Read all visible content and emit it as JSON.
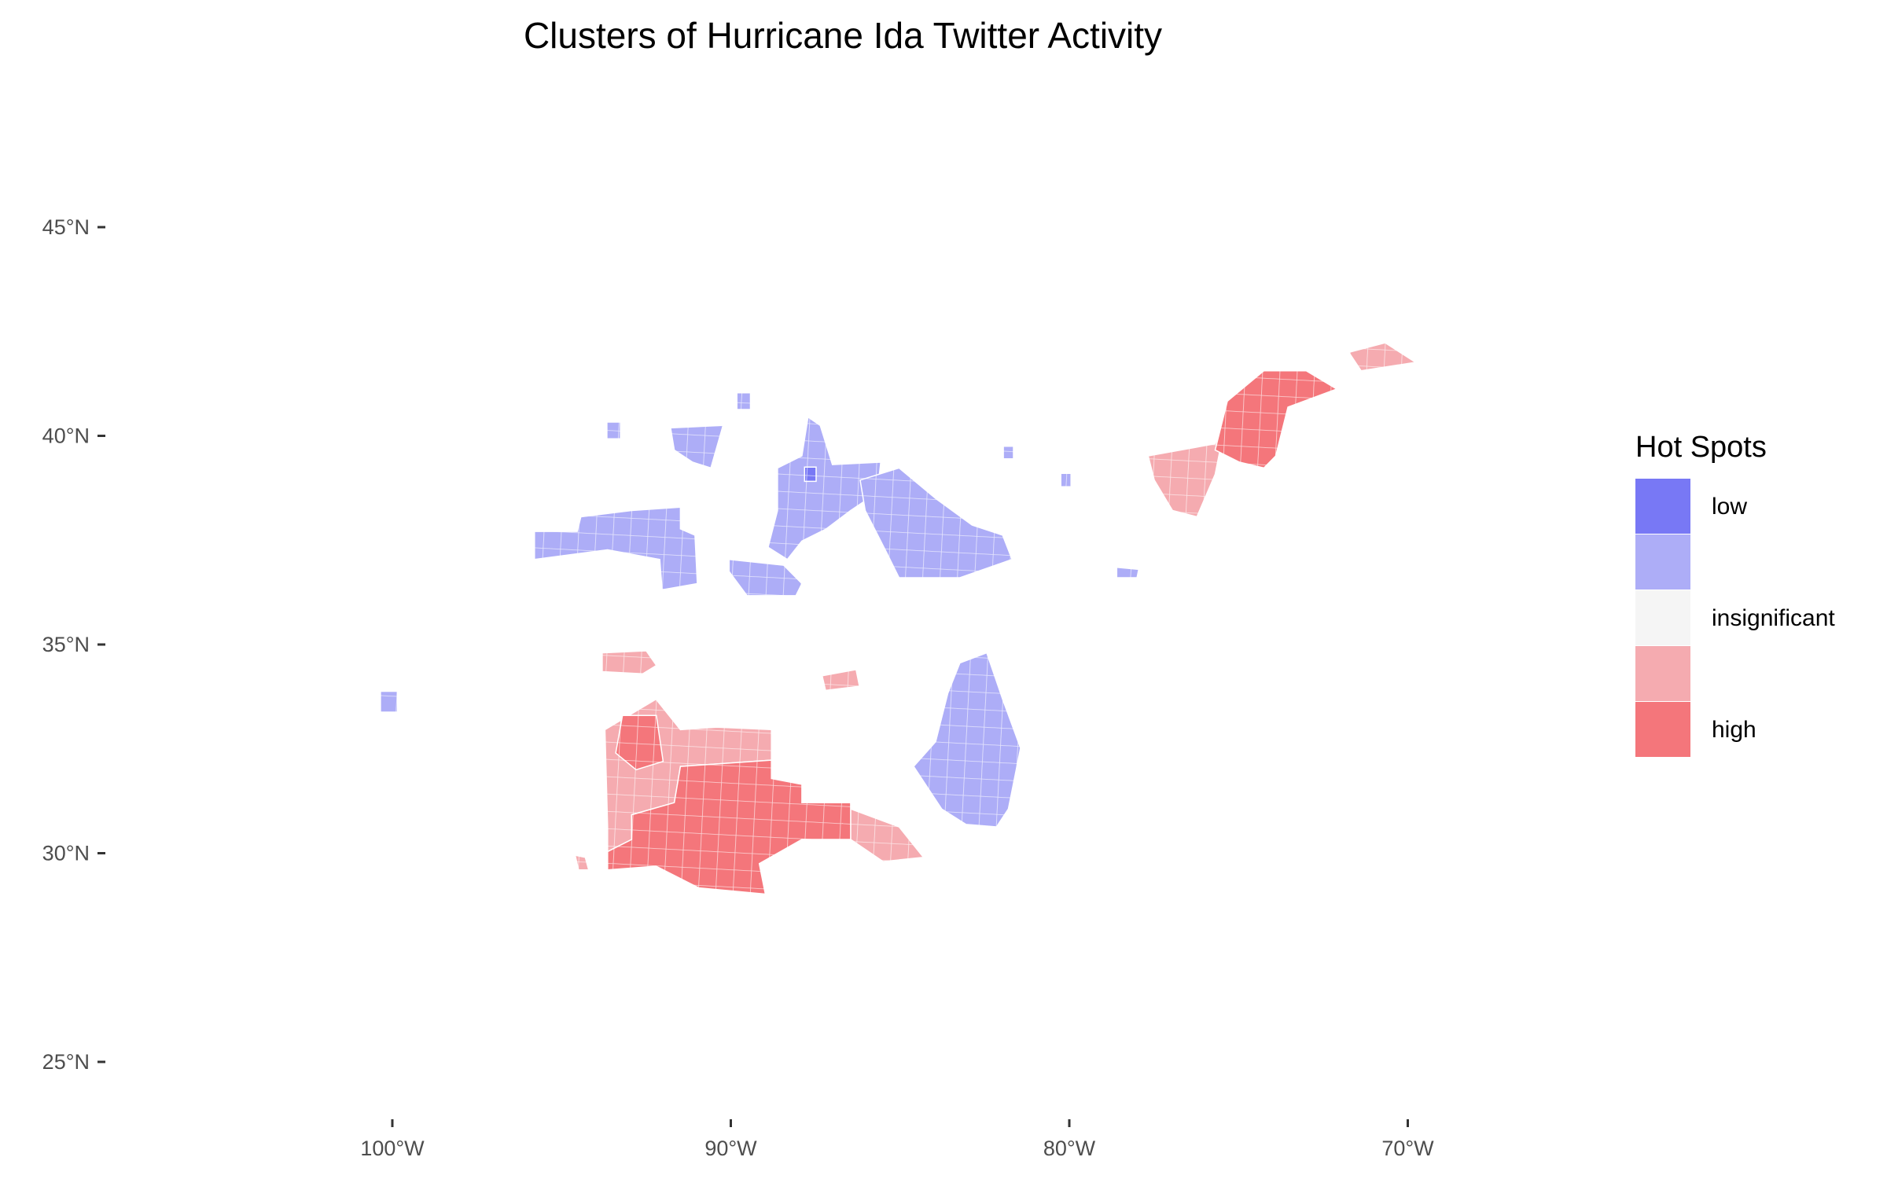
{
  "chart_data": {
    "type": "choropleth-map",
    "title": "Clusters of Hurricane Ida Twitter Activity",
    "xlabel": "",
    "ylabel": "",
    "x_ticks": [
      {
        "value": -100,
        "label": "100°W"
      },
      {
        "value": -90,
        "label": "90°W"
      },
      {
        "value": -80,
        "label": "80°W"
      },
      {
        "value": -70,
        "label": "70°W"
      }
    ],
    "y_ticks": [
      {
        "value": 45,
        "label": "45°N"
      },
      {
        "value": 40,
        "label": "40°N"
      },
      {
        "value": 35,
        "label": "35°N"
      },
      {
        "value": 30,
        "label": "30°N"
      },
      {
        "value": 25,
        "label": "25°N"
      }
    ],
    "grid": false,
    "legend": {
      "title": "Hot Spots",
      "placement": "right",
      "classes": [
        {
          "key": "low",
          "label": "low",
          "color": "#7878F5"
        },
        {
          "key": "low2",
          "label": "",
          "color": "#ADADF7"
        },
        {
          "key": "insig",
          "label": "insignificant",
          "color": "#F5F5F5"
        },
        {
          "key": "high2",
          "label": "",
          "color": "#F5ABB0"
        },
        {
          "key": "high",
          "label": "high",
          "color": "#F4767B"
        }
      ]
    },
    "regions": [
      {
        "cls": "high2",
        "lonlat": [
          [
            -93.72,
            32.96
          ],
          [
            -92.21,
            33.69
          ],
          [
            -91.49,
            32.96
          ],
          [
            -90.41,
            33.02
          ],
          [
            -88.8,
            32.96
          ],
          [
            -88.8,
            32.23
          ],
          [
            -91.49,
            32.08
          ],
          [
            -91.67,
            31.21
          ],
          [
            -92.93,
            30.92
          ],
          [
            -92.93,
            30.33
          ],
          [
            -93.64,
            30.04
          ],
          [
            -93.64,
            30.63
          ]
        ]
      },
      {
        "cls": "high2",
        "lonlat": [
          [
            -86.46,
            31.06
          ],
          [
            -85.03,
            30.63
          ],
          [
            -84.31,
            29.9
          ],
          [
            -85.5,
            29.8
          ],
          [
            -86.46,
            30.33
          ]
        ]
      },
      {
        "cls": "high2",
        "lonlat": [
          [
            -93.8,
            34.8
          ],
          [
            -92.5,
            34.85
          ],
          [
            -92.2,
            34.5
          ],
          [
            -92.6,
            34.3
          ],
          [
            -93.8,
            34.35
          ]
        ]
      },
      {
        "cls": "high2",
        "lonlat": [
          [
            -87.3,
            34.25
          ],
          [
            -86.3,
            34.4
          ],
          [
            -86.2,
            34.0
          ],
          [
            -87.2,
            33.9
          ]
        ]
      },
      {
        "cls": "high2",
        "lonlat": [
          [
            -94.6,
            29.95
          ],
          [
            -94.3,
            29.9
          ],
          [
            -94.2,
            29.6
          ],
          [
            -94.5,
            29.6
          ]
        ]
      },
      {
        "cls": "high",
        "lonlat": [
          [
            -93.64,
            30.04
          ],
          [
            -93.64,
            29.6
          ],
          [
            -92.21,
            29.69
          ],
          [
            -90.95,
            29.17
          ],
          [
            -88.98,
            29.02
          ],
          [
            -89.16,
            29.75
          ],
          [
            -87.9,
            30.33
          ],
          [
            -86.46,
            30.33
          ],
          [
            -86.46,
            31.21
          ],
          [
            -87.9,
            31.21
          ],
          [
            -87.9,
            31.65
          ],
          [
            -88.8,
            31.79
          ],
          [
            -88.8,
            32.23
          ],
          [
            -91.49,
            32.08
          ],
          [
            -91.67,
            31.21
          ],
          [
            -92.93,
            30.92
          ],
          [
            -92.93,
            30.33
          ]
        ]
      },
      {
        "cls": "high",
        "lonlat": [
          [
            -93.2,
            33.3
          ],
          [
            -92.2,
            33.3
          ],
          [
            -92.0,
            32.2
          ],
          [
            -92.8,
            32.0
          ],
          [
            -93.4,
            32.4
          ]
        ]
      },
      {
        "cls": "high2",
        "lonlat": [
          [
            -77.67,
            39.52
          ],
          [
            -75.69,
            39.81
          ],
          [
            -75.33,
            40.54
          ],
          [
            -75.69,
            39.08
          ],
          [
            -76.23,
            38.06
          ],
          [
            -76.95,
            38.21
          ],
          [
            -77.49,
            38.94
          ]
        ]
      },
      {
        "cls": "high",
        "lonlat": [
          [
            -75.69,
            39.66
          ],
          [
            -75.33,
            40.83
          ],
          [
            -74.25,
            41.56
          ],
          [
            -73.0,
            41.56
          ],
          [
            -72.1,
            41.12
          ],
          [
            -73.54,
            40.69
          ],
          [
            -73.9,
            39.52
          ],
          [
            -74.25,
            39.23
          ],
          [
            -74.97,
            39.37
          ]
        ]
      },
      {
        "cls": "high2",
        "lonlat": [
          [
            -71.74,
            42.0
          ],
          [
            -70.67,
            42.23
          ],
          [
            -69.77,
            41.76
          ],
          [
            -71.38,
            41.56
          ]
        ]
      },
      {
        "cls": "low2",
        "lonlat": [
          [
            -95.8,
            37.71
          ],
          [
            -94.54,
            37.71
          ],
          [
            -94.43,
            38.06
          ],
          [
            -92.93,
            38.21
          ],
          [
            -91.49,
            38.29
          ],
          [
            -91.49,
            37.77
          ],
          [
            -91.06,
            37.62
          ],
          [
            -90.99,
            36.46
          ],
          [
            -92.03,
            36.31
          ],
          [
            -92.1,
            37.04
          ],
          [
            -93.64,
            37.27
          ],
          [
            -95.8,
            37.04
          ]
        ]
      },
      {
        "cls": "low2",
        "lonlat": [
          [
            -88.62,
            39.23
          ],
          [
            -87.9,
            39.52
          ],
          [
            -87.72,
            40.45
          ],
          [
            -87.36,
            40.25
          ],
          [
            -87.0,
            39.31
          ],
          [
            -85.57,
            39.37
          ],
          [
            -85.67,
            38.64
          ],
          [
            -86.46,
            38.21
          ],
          [
            -87.18,
            37.77
          ],
          [
            -87.9,
            37.48
          ],
          [
            -88.33,
            37.04
          ],
          [
            -88.9,
            37.33
          ],
          [
            -88.62,
            38.21
          ]
        ]
      },
      {
        "cls": "low2",
        "lonlat": [
          [
            -86.18,
            38.94
          ],
          [
            -85.03,
            39.23
          ],
          [
            -83.95,
            38.5
          ],
          [
            -82.87,
            37.86
          ],
          [
            -81.97,
            37.62
          ],
          [
            -81.69,
            37.04
          ],
          [
            -83.23,
            36.6
          ],
          [
            -85.03,
            36.6
          ],
          [
            -85.39,
            37.19
          ],
          [
            -86.03,
            38.21
          ]
        ]
      },
      {
        "cls": "low2",
        "lonlat": [
          [
            -83.23,
            34.56
          ],
          [
            -82.44,
            34.8
          ],
          [
            -81.97,
            33.69
          ],
          [
            -81.44,
            32.52
          ],
          [
            -81.8,
            31.06
          ],
          [
            -82.15,
            30.63
          ],
          [
            -83.05,
            30.69
          ],
          [
            -83.77,
            31.06
          ],
          [
            -84.6,
            32.08
          ],
          [
            -83.95,
            32.67
          ],
          [
            -83.59,
            33.83
          ]
        ]
      },
      {
        "cls": "low2",
        "lonlat": [
          [
            -91.78,
            40.19
          ],
          [
            -90.23,
            40.25
          ],
          [
            -90.59,
            39.23
          ],
          [
            -91.13,
            39.37
          ],
          [
            -91.67,
            39.66
          ]
        ]
      },
      {
        "cls": "low2",
        "lonlat": [
          [
            -90.05,
            37.04
          ],
          [
            -88.44,
            36.9
          ],
          [
            -87.9,
            36.46
          ],
          [
            -88.08,
            36.17
          ],
          [
            -89.52,
            36.17
          ],
          [
            -90.05,
            36.75
          ]
        ]
      },
      {
        "cls": "low2",
        "lonlat": [
          [
            -93.66,
            40.33
          ],
          [
            -93.26,
            40.33
          ],
          [
            -93.26,
            39.93
          ],
          [
            -93.66,
            39.93
          ]
        ]
      },
      {
        "cls": "low2",
        "lonlat": [
          [
            -89.82,
            41.03
          ],
          [
            -89.42,
            41.03
          ],
          [
            -89.42,
            40.63
          ],
          [
            -89.82,
            40.63
          ]
        ]
      },
      {
        "cls": "low2",
        "lonlat": [
          [
            -100.35,
            33.88
          ],
          [
            -99.85,
            33.88
          ],
          [
            -99.85,
            33.38
          ],
          [
            -100.35,
            33.38
          ]
        ]
      },
      {
        "cls": "low2",
        "lonlat": [
          [
            -81.95,
            39.75
          ],
          [
            -81.65,
            39.75
          ],
          [
            -81.65,
            39.45
          ],
          [
            -81.95,
            39.45
          ]
        ]
      },
      {
        "cls": "low2",
        "lonlat": [
          [
            -80.25,
            39.1
          ],
          [
            -79.95,
            39.1
          ],
          [
            -79.95,
            38.78
          ],
          [
            -80.25,
            38.78
          ]
        ]
      },
      {
        "cls": "low2",
        "lonlat": [
          [
            -78.6,
            36.85
          ],
          [
            -77.95,
            36.8
          ],
          [
            -78.0,
            36.6
          ],
          [
            -78.6,
            36.6
          ]
        ]
      },
      {
        "cls": "low",
        "lonlat": [
          [
            -87.82,
            39.25
          ],
          [
            -87.48,
            39.25
          ],
          [
            -87.48,
            38.91
          ],
          [
            -87.82,
            38.91
          ]
        ]
      }
    ]
  }
}
